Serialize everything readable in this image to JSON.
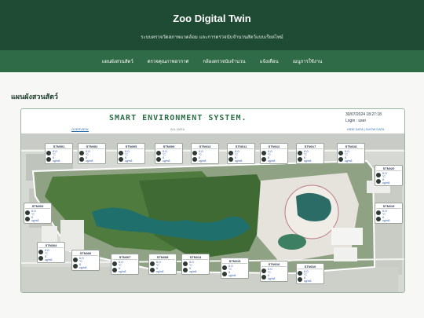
{
  "header": {
    "title": "Zoo Digital Twin",
    "subtitle": "ระบบตรวจวัดสภาพแวดล้อม และการตรวจนับจำนวนสัตว์แบบเรียลไทม์"
  },
  "nav": {
    "items": [
      {
        "label": "แผนผังสวนสัตว์"
      },
      {
        "label": "ตรวจคุณภาพอากาศ"
      },
      {
        "label": "กล้องตรวจนับจำนวน"
      },
      {
        "label": "แจ้งเตือน"
      },
      {
        "label": "เมนูการใช้งาน"
      }
    ]
  },
  "section": {
    "title": "แผนผังสวนสัตว์"
  },
  "panel": {
    "system_title": "SMART ENVIRONMENT SYSTEM.",
    "datetime": "30/07/2024   18:27:18",
    "login": "Login : user",
    "toggle": "HIDE DATA | SHOW DATA",
    "tabs": [
      "OVERVIEW",
      "ALL DATA"
    ]
  },
  "stations": [
    {
      "name": "STN001",
      "temp": "0.0",
      "temp_unit": "°C",
      "pm": "0",
      "pm_unit": "ug/m3"
    },
    {
      "name": "STN002",
      "temp": "0.0",
      "temp_unit": "°C",
      "pm": "0",
      "pm_unit": "ug/m3"
    },
    {
      "name": "STN005",
      "temp": "0.0",
      "temp_unit": "°C",
      "pm": "0",
      "pm_unit": "ug/m3"
    },
    {
      "name": "STN009",
      "temp": "0.0",
      "temp_unit": "°C",
      "pm": "0",
      "pm_unit": "ug/m3"
    },
    {
      "name": "STN013",
      "temp": "0.0",
      "temp_unit": "°C",
      "pm": "0",
      "pm_unit": "ug/m3"
    },
    {
      "name": "STN011",
      "temp": "0.0",
      "temp_unit": "°C",
      "pm": "0",
      "pm_unit": "ug/m3"
    },
    {
      "name": "STN012",
      "temp": "0.0",
      "temp_unit": "°C",
      "pm": "0",
      "pm_unit": "ug/m3"
    },
    {
      "name": "STN017",
      "temp": "0.0",
      "temp_unit": "°C",
      "pm": "0",
      "pm_unit": "ug/m3"
    },
    {
      "name": "STN018",
      "temp": "0.0",
      "temp_unit": "°C",
      "pm": "0",
      "pm_unit": "ug/m3"
    },
    {
      "name": "STN020",
      "temp": "0.0",
      "temp_unit": "°C",
      "pm": "0",
      "pm_unit": "ug/m3"
    },
    {
      "name": "STN003",
      "temp": "0.0",
      "temp_unit": "°C",
      "pm": "0",
      "pm_unit": "ug/m3"
    },
    {
      "name": "STN019",
      "temp": "0.0",
      "temp_unit": "°C",
      "pm": "0",
      "pm_unit": "ug/m3"
    },
    {
      "name": "STN004",
      "temp": "0.0",
      "temp_unit": "°C",
      "pm": "0",
      "pm_unit": "ug/m3"
    },
    {
      "name": "STN006",
      "temp": "0.0",
      "temp_unit": "°C",
      "pm": "0",
      "pm_unit": "ug/m3"
    },
    {
      "name": "STN007",
      "temp": "0.0",
      "temp_unit": "°C",
      "pm": "0",
      "pm_unit": "ug/m3"
    },
    {
      "name": "STN008",
      "temp": "0.0",
      "temp_unit": "°C",
      "pm": "0",
      "pm_unit": "ug/m3"
    },
    {
      "name": "STN014",
      "temp": "0.0",
      "temp_unit": "°C",
      "pm": "0",
      "pm_unit": "ug/m3"
    },
    {
      "name": "STN015",
      "temp": "0.0",
      "temp_unit": "°C",
      "pm": "0",
      "pm_unit": "ug/m3"
    },
    {
      "name": "STN016",
      "temp": "0.0",
      "temp_unit": "°C",
      "pm": "0",
      "pm_unit": "ug/m3"
    },
    {
      "name": "STN010",
      "temp": "0.0",
      "temp_unit": "°C",
      "pm": "0",
      "pm_unit": "ug/m3"
    }
  ],
  "icons": {
    "temperature": "thermometer-icon",
    "pm": "dust-sensor-icon"
  },
  "colors": {
    "header": "#1f4a33",
    "nav": "#2f6b46",
    "accent": "#2d6b45",
    "value": "#2450a4"
  }
}
